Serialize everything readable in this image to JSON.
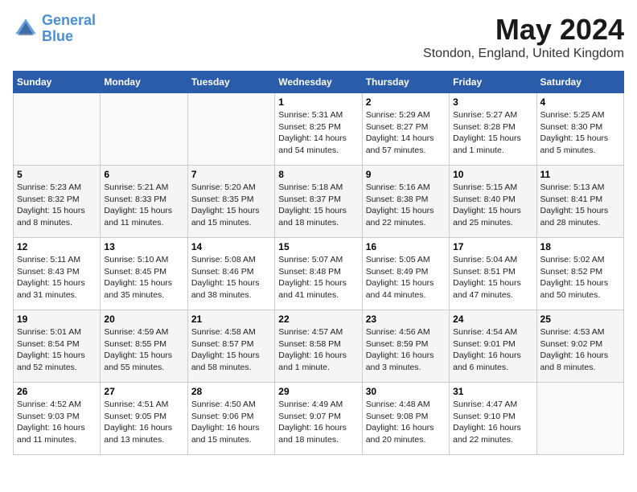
{
  "header": {
    "logo_line1": "General",
    "logo_line2": "Blue",
    "main_title": "May 2024",
    "subtitle": "Stondon, England, United Kingdom"
  },
  "days_of_week": [
    "Sunday",
    "Monday",
    "Tuesday",
    "Wednesday",
    "Thursday",
    "Friday",
    "Saturday"
  ],
  "weeks": [
    [
      {
        "day": "",
        "info": ""
      },
      {
        "day": "",
        "info": ""
      },
      {
        "day": "",
        "info": ""
      },
      {
        "day": "1",
        "info": "Sunrise: 5:31 AM\nSunset: 8:25 PM\nDaylight: 14 hours\nand 54 minutes."
      },
      {
        "day": "2",
        "info": "Sunrise: 5:29 AM\nSunset: 8:27 PM\nDaylight: 14 hours\nand 57 minutes."
      },
      {
        "day": "3",
        "info": "Sunrise: 5:27 AM\nSunset: 8:28 PM\nDaylight: 15 hours\nand 1 minute."
      },
      {
        "day": "4",
        "info": "Sunrise: 5:25 AM\nSunset: 8:30 PM\nDaylight: 15 hours\nand 5 minutes."
      }
    ],
    [
      {
        "day": "5",
        "info": "Sunrise: 5:23 AM\nSunset: 8:32 PM\nDaylight: 15 hours\nand 8 minutes."
      },
      {
        "day": "6",
        "info": "Sunrise: 5:21 AM\nSunset: 8:33 PM\nDaylight: 15 hours\nand 11 minutes."
      },
      {
        "day": "7",
        "info": "Sunrise: 5:20 AM\nSunset: 8:35 PM\nDaylight: 15 hours\nand 15 minutes."
      },
      {
        "day": "8",
        "info": "Sunrise: 5:18 AM\nSunset: 8:37 PM\nDaylight: 15 hours\nand 18 minutes."
      },
      {
        "day": "9",
        "info": "Sunrise: 5:16 AM\nSunset: 8:38 PM\nDaylight: 15 hours\nand 22 minutes."
      },
      {
        "day": "10",
        "info": "Sunrise: 5:15 AM\nSunset: 8:40 PM\nDaylight: 15 hours\nand 25 minutes."
      },
      {
        "day": "11",
        "info": "Sunrise: 5:13 AM\nSunset: 8:41 PM\nDaylight: 15 hours\nand 28 minutes."
      }
    ],
    [
      {
        "day": "12",
        "info": "Sunrise: 5:11 AM\nSunset: 8:43 PM\nDaylight: 15 hours\nand 31 minutes."
      },
      {
        "day": "13",
        "info": "Sunrise: 5:10 AM\nSunset: 8:45 PM\nDaylight: 15 hours\nand 35 minutes."
      },
      {
        "day": "14",
        "info": "Sunrise: 5:08 AM\nSunset: 8:46 PM\nDaylight: 15 hours\nand 38 minutes."
      },
      {
        "day": "15",
        "info": "Sunrise: 5:07 AM\nSunset: 8:48 PM\nDaylight: 15 hours\nand 41 minutes."
      },
      {
        "day": "16",
        "info": "Sunrise: 5:05 AM\nSunset: 8:49 PM\nDaylight: 15 hours\nand 44 minutes."
      },
      {
        "day": "17",
        "info": "Sunrise: 5:04 AM\nSunset: 8:51 PM\nDaylight: 15 hours\nand 47 minutes."
      },
      {
        "day": "18",
        "info": "Sunrise: 5:02 AM\nSunset: 8:52 PM\nDaylight: 15 hours\nand 50 minutes."
      }
    ],
    [
      {
        "day": "19",
        "info": "Sunrise: 5:01 AM\nSunset: 8:54 PM\nDaylight: 15 hours\nand 52 minutes."
      },
      {
        "day": "20",
        "info": "Sunrise: 4:59 AM\nSunset: 8:55 PM\nDaylight: 15 hours\nand 55 minutes."
      },
      {
        "day": "21",
        "info": "Sunrise: 4:58 AM\nSunset: 8:57 PM\nDaylight: 15 hours\nand 58 minutes."
      },
      {
        "day": "22",
        "info": "Sunrise: 4:57 AM\nSunset: 8:58 PM\nDaylight: 16 hours\nand 1 minute."
      },
      {
        "day": "23",
        "info": "Sunrise: 4:56 AM\nSunset: 8:59 PM\nDaylight: 16 hours\nand 3 minutes."
      },
      {
        "day": "24",
        "info": "Sunrise: 4:54 AM\nSunset: 9:01 PM\nDaylight: 16 hours\nand 6 minutes."
      },
      {
        "day": "25",
        "info": "Sunrise: 4:53 AM\nSunset: 9:02 PM\nDaylight: 16 hours\nand 8 minutes."
      }
    ],
    [
      {
        "day": "26",
        "info": "Sunrise: 4:52 AM\nSunset: 9:03 PM\nDaylight: 16 hours\nand 11 minutes."
      },
      {
        "day": "27",
        "info": "Sunrise: 4:51 AM\nSunset: 9:05 PM\nDaylight: 16 hours\nand 13 minutes."
      },
      {
        "day": "28",
        "info": "Sunrise: 4:50 AM\nSunset: 9:06 PM\nDaylight: 16 hours\nand 15 minutes."
      },
      {
        "day": "29",
        "info": "Sunrise: 4:49 AM\nSunset: 9:07 PM\nDaylight: 16 hours\nand 18 minutes."
      },
      {
        "day": "30",
        "info": "Sunrise: 4:48 AM\nSunset: 9:08 PM\nDaylight: 16 hours\nand 20 minutes."
      },
      {
        "day": "31",
        "info": "Sunrise: 4:47 AM\nSunset: 9:10 PM\nDaylight: 16 hours\nand 22 minutes."
      },
      {
        "day": "",
        "info": ""
      }
    ]
  ]
}
